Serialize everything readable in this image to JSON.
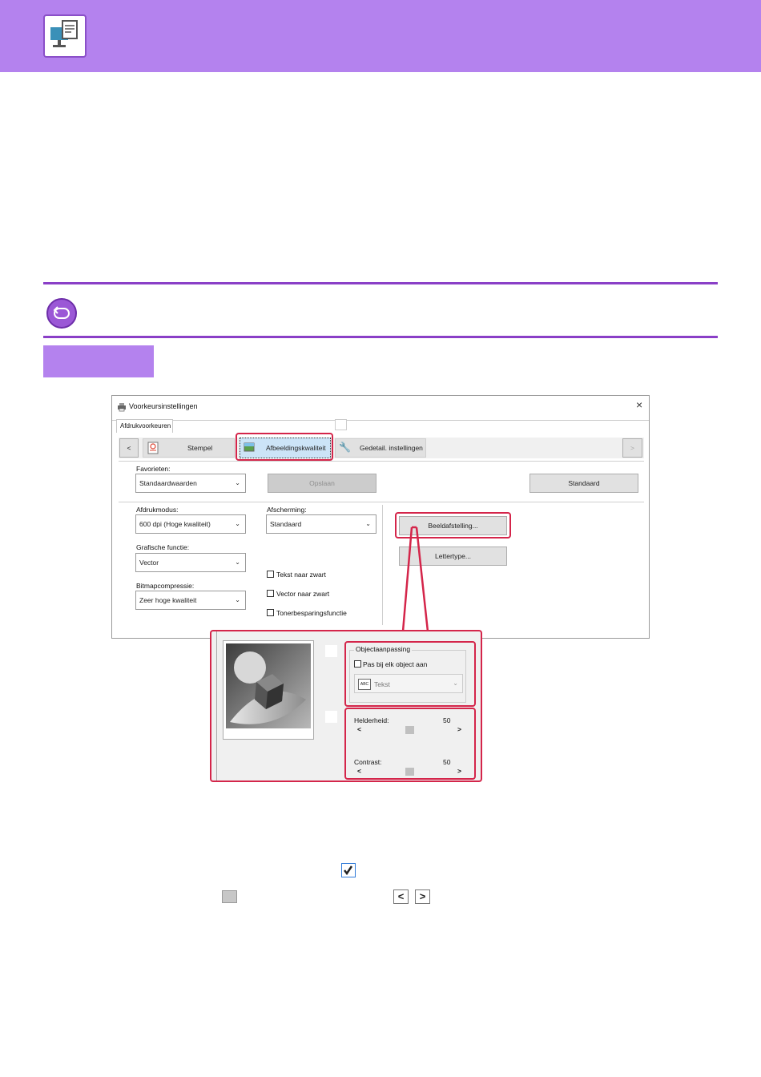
{
  "dialog": {
    "title": "Voorkeursinstellingen",
    "close": "×",
    "tab_label": "Afdrukvoorkeuren",
    "toolbar": {
      "prev": "<",
      "next": ">",
      "stempel": "Stempel",
      "afbeeldingskwaliteit": "Afbeeldingskwaliteit",
      "gedetailleerd": "Gedetail. instellingen"
    },
    "favorieten": {
      "label": "Favorieten:",
      "value": "Standaardwaarden"
    },
    "opslaan": "Opslaan",
    "standaard": "Standaard",
    "afdrukmodus": {
      "label": "Afdrukmodus:",
      "value": "600 dpi (Hoge kwaliteit)"
    },
    "afscherming": {
      "label": "Afscherming:",
      "value": "Standaard"
    },
    "grafische_functie": {
      "label": "Grafische functie:",
      "value": "Vector"
    },
    "bitmapcompressie": {
      "label": "Bitmapcompressie:",
      "value": "Zeer hoge kwaliteit"
    },
    "tekst_naar_zwart": "Tekst naar zwart",
    "vector_naar_zwart": "Vector naar zwart",
    "tonerbesparingsfunctie": "Tonerbesparingsfunctie",
    "beeldafstelling": "Beeldafstelling...",
    "lettertype": "Lettertype..."
  },
  "popup": {
    "objectaanpassing": "Objectaanpassing",
    "pas_bij_elk_object": "Pas bij elk object aan",
    "object_select": {
      "icon": "ABC",
      "value": "Tekst"
    },
    "helderheid": {
      "label": "Helderheid:",
      "value": "50",
      "left": "<",
      "right": ">"
    },
    "contrast": {
      "label": "Contrast:",
      "value": "50",
      "left": "<",
      "right": ">"
    }
  },
  "bottom_icons": {
    "left_arrow": "<",
    "right_arrow": ">"
  },
  "colors": {
    "header": "#b482ee",
    "accent_line": "#8a3fc7",
    "highlight": "#d4254a",
    "checkbox_blue": "#2f7ad8"
  },
  "slider_levels": {
    "helderheid": 50,
    "contrast": 50
  }
}
